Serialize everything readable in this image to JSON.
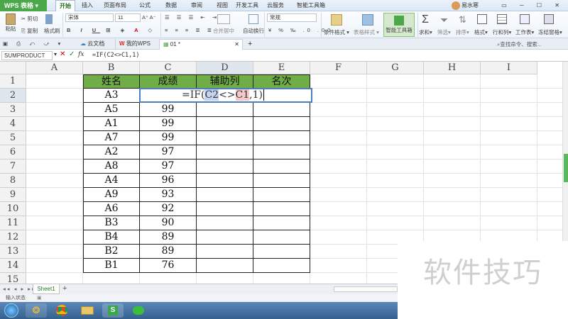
{
  "app": {
    "name": "WPS 表格"
  },
  "menu": {
    "items": [
      "开始",
      "插入",
      "页面布局",
      "公式",
      "数据",
      "审阅",
      "视图",
      "开发工具",
      "云服务",
      "智能工具箱"
    ],
    "active_index": 0
  },
  "user": {
    "name": "易水寒"
  },
  "ribbon": {
    "cut": "剪切",
    "paste": "粘贴",
    "copy": "复制",
    "format_brush": "格式刷",
    "font_name": "宋体",
    "font_size": "11",
    "merge_center": "合并居中",
    "wrap": "自动换行",
    "number_format": "常规",
    "cond_format": "条件格式",
    "table_style": "表格样式",
    "smart_toolbox": "智能工具箱",
    "sum": "求和",
    "filter": "筛选",
    "sort": "排序",
    "format": "格式",
    "row_col": "行和列",
    "worksheet": "工作表",
    "freeze": "冻结窗格"
  },
  "tabs": {
    "cloud_docs": "云文档",
    "my_wps": "我的WPS",
    "doc": "01 *",
    "search": "查找命令、搜索..."
  },
  "formula_bar": {
    "name_box": "SUMPRODUCT",
    "formula": "=IF(C2<>C1,1)",
    "fx": "fx"
  },
  "columns": [
    "A",
    "B",
    "C",
    "D",
    "E",
    "F",
    "G",
    "H",
    "I"
  ],
  "rows": [
    "1",
    "2",
    "3",
    "4",
    "5",
    "6",
    "7",
    "8",
    "9",
    "10",
    "11",
    "12",
    "13",
    "14",
    "15"
  ],
  "table": {
    "headers": [
      "姓名",
      "成绩",
      "辅助列",
      "名次"
    ],
    "names": [
      "A3",
      "A5",
      "A1",
      "A7",
      "A2",
      "A8",
      "A4",
      "A9",
      "A6",
      "B3",
      "B4",
      "B2",
      "B1"
    ],
    "scores": [
      "",
      "99",
      "99",
      "99",
      "97",
      "97",
      "96",
      "93",
      "92",
      "90",
      "89",
      "89",
      "76"
    ],
    "editing_cell_text": "=IF(C2<>C1,1)",
    "edit_parts": {
      "pre": "=IF(",
      "ref1": "C2",
      "op": "<>",
      "ref2": "C1",
      "post": ",1)"
    }
  },
  "sheet": {
    "name": "Sheet1"
  },
  "status": {
    "mode": "输入状态"
  },
  "watermark": "软件技巧",
  "colors": {
    "header_fill": "#70ad47",
    "ref1_highlight": "#c5d3ef",
    "ref2_highlight": "#f2c8c8",
    "active_tab": "#4aa84a"
  }
}
